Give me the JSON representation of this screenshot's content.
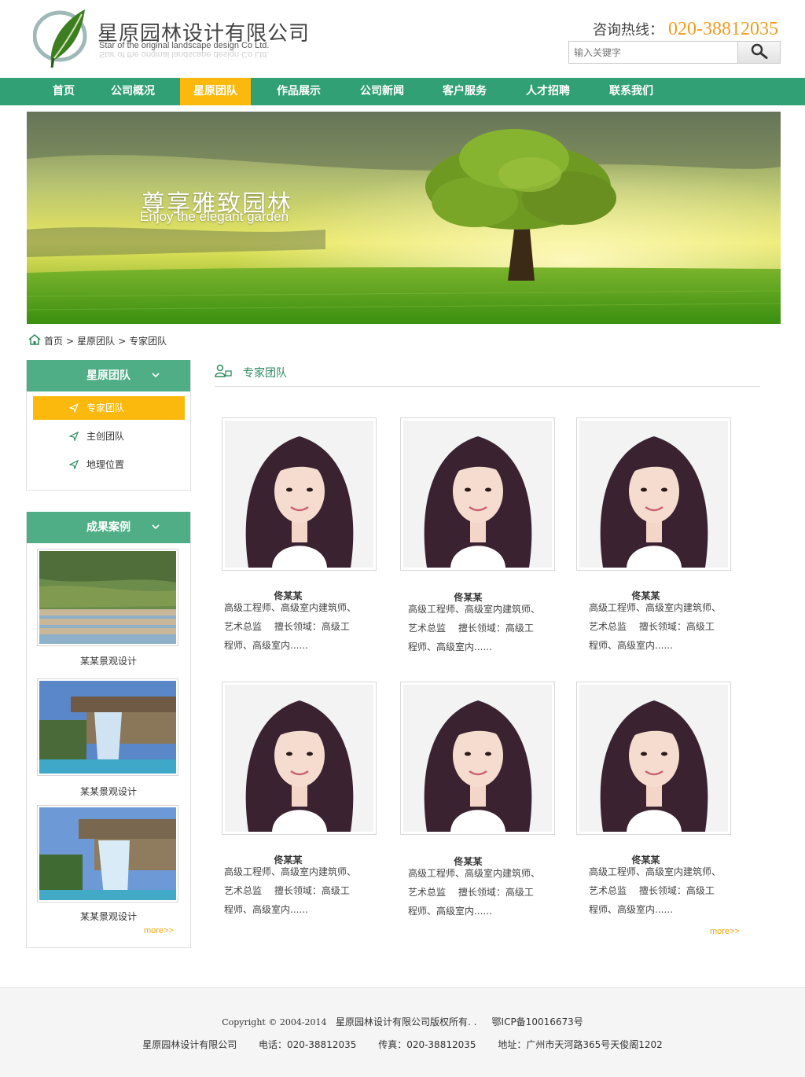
{
  "header": {
    "company_name": "星原园林设计有限公司",
    "company_name_en": "Star of the original landscape design Co Ltd.",
    "hotline_label": "咨询热线",
    "hotline_sep": "：",
    "hotline_number": "020-38812035",
    "search_placeholder": "输入关键字",
    "search_icon": "search-icon"
  },
  "nav": {
    "items": [
      {
        "label": "首页"
      },
      {
        "label": "公司概况"
      },
      {
        "label": "星原团队"
      },
      {
        "label": "作品展示"
      },
      {
        "label": "公司新闻"
      },
      {
        "label": "客户服务"
      },
      {
        "label": "人才招聘"
      },
      {
        "label": "联系我们"
      }
    ],
    "active_index": 2
  },
  "banner": {
    "title": "尊享雅致园林",
    "subtitle": "Enjoy the elegant garden"
  },
  "breadcrumb": {
    "home_icon": "home-icon",
    "items": [
      "首页",
      "星原团队",
      "专家团队"
    ],
    "separator": ">"
  },
  "sidebar": {
    "team": {
      "title": "星原团队",
      "items": [
        {
          "label": "专家团队",
          "active": true
        },
        {
          "label": "主创团队",
          "active": false
        },
        {
          "label": "地理位置",
          "active": false
        }
      ]
    },
    "cases": {
      "title": "成果案例",
      "items": [
        {
          "caption": "某某景观设计"
        },
        {
          "caption": "某某景观设计"
        },
        {
          "caption": "某某景观设计"
        }
      ],
      "more": "more>>"
    }
  },
  "main": {
    "title": "专家团队",
    "members": [
      {
        "name": "佟某某",
        "desc_lines": [
          "高级工程师、高级室内建筑师、",
          "艺术总监　 擅长领域：高级工",
          "程师、高级室内......"
        ]
      },
      {
        "name": "佟某某",
        "desc_lines": [
          "高级工程师、高级室内建筑师、",
          "艺术总监　 擅长领域：高级工",
          "程师、高级室内......"
        ]
      },
      {
        "name": "佟某某",
        "desc_lines": [
          "高级工程师、高级室内建筑师、",
          "艺术总监　 擅长领域：高级工",
          "程师、高级室内......"
        ]
      },
      {
        "name": "佟某某",
        "desc_lines": [
          "高级工程师、高级室内建筑师、",
          "艺术总监　 擅长领域：高级工",
          "程师、高级室内......"
        ]
      },
      {
        "name": "佟某某",
        "desc_lines": [
          "高级工程师、高级室内建筑师、",
          "艺术总监　 擅长领域：高级工",
          "程师、高级室内......"
        ]
      },
      {
        "name": "佟某某",
        "desc_lines": [
          "高级工程师、高级室内建筑师、",
          "艺术总监　 擅长领域：高级工",
          "程师、高级室内......"
        ]
      }
    ],
    "more": "more>>"
  },
  "footer": {
    "copyright": "Copyright © 2004-2014",
    "rights": "星原园林设计有限公司版权所有. .",
    "icp": "鄂ICP备10016673号",
    "company": "星原园林设计有限公司",
    "phone": "电话：020-38812035",
    "fax": "传真：020-38812035",
    "address": "地址：广州市天河路365号天俊阁1202"
  },
  "colors": {
    "brand_green": "#31a074",
    "sidebar_green": "#4fae86",
    "accent_orange": "#fbb90d",
    "hotline_orange": "#f59a1b"
  }
}
